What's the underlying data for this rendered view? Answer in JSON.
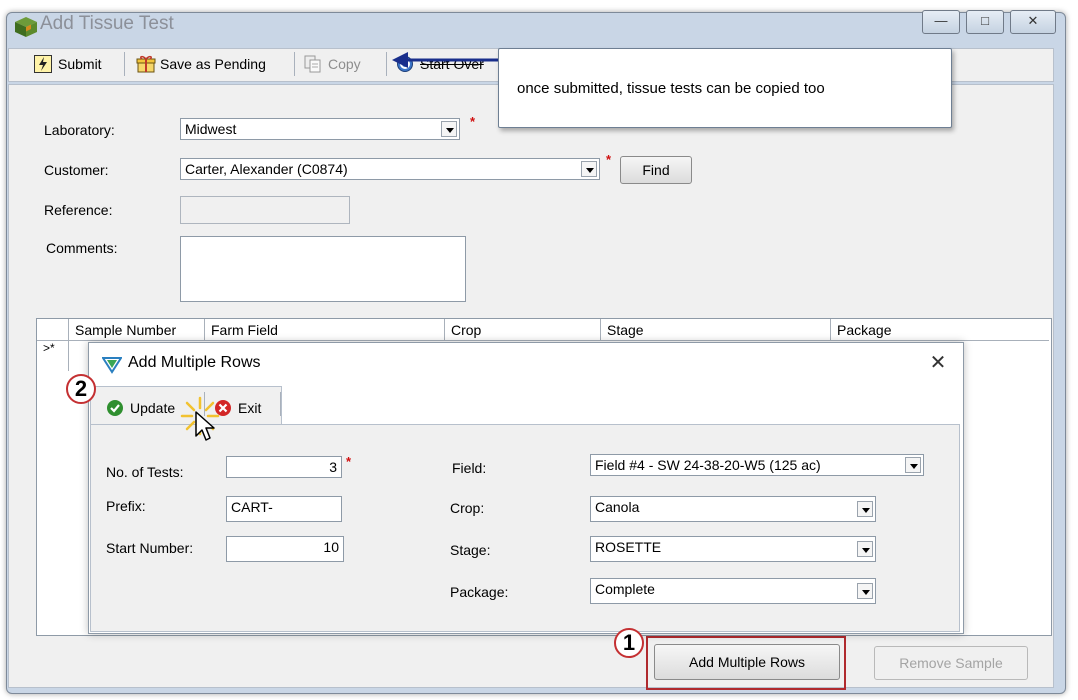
{
  "window": {
    "title": "Add Tissue Test"
  },
  "toolbar": {
    "submit_label": "Submit",
    "save_pending_label": "Save as Pending",
    "copy_label": "Copy",
    "start_over_label": "Start Over"
  },
  "tooltip": {
    "text": "once submitted, tissue tests can be copied too"
  },
  "form": {
    "laboratory_label": "Laboratory:",
    "laboratory_value": "Midwest",
    "customer_label": "Customer:",
    "customer_value": "Carter, Alexander (C0874)",
    "find_label": "Find",
    "reference_label": "Reference:",
    "reference_value": "",
    "comments_label": "Comments:",
    "required_mark": "*"
  },
  "grid": {
    "columns": [
      "Sample Number",
      "Farm Field",
      "Crop",
      "Stage",
      "Package"
    ],
    "new_row_marker": ">*"
  },
  "dialog": {
    "title": "Add Multiple Rows",
    "update_label": "Update",
    "exit_label": "Exit",
    "no_tests_label": "No. of Tests:",
    "no_tests_value": "3",
    "prefix_label": "Prefix:",
    "prefix_value": "CART-",
    "start_number_label": "Start Number:",
    "start_number_value": "10",
    "field_label": "Field:",
    "field_value": "Field #4 - SW 24-38-20-W5 (125 ac)",
    "crop_label": "Crop:",
    "crop_value": "Canola",
    "stage_label": "Stage:",
    "stage_value": "ROSETTE",
    "package_label": "Package:",
    "package_value": "Complete",
    "close_glyph": "✕"
  },
  "bottom": {
    "add_rows_label": "Add Multiple Rows",
    "remove_label": "Remove Sample"
  },
  "callouts": {
    "one": "1",
    "two": "2"
  },
  "colors": {
    "accent_red": "#c43032",
    "tooltip_arrow": "#1a2f8c"
  }
}
